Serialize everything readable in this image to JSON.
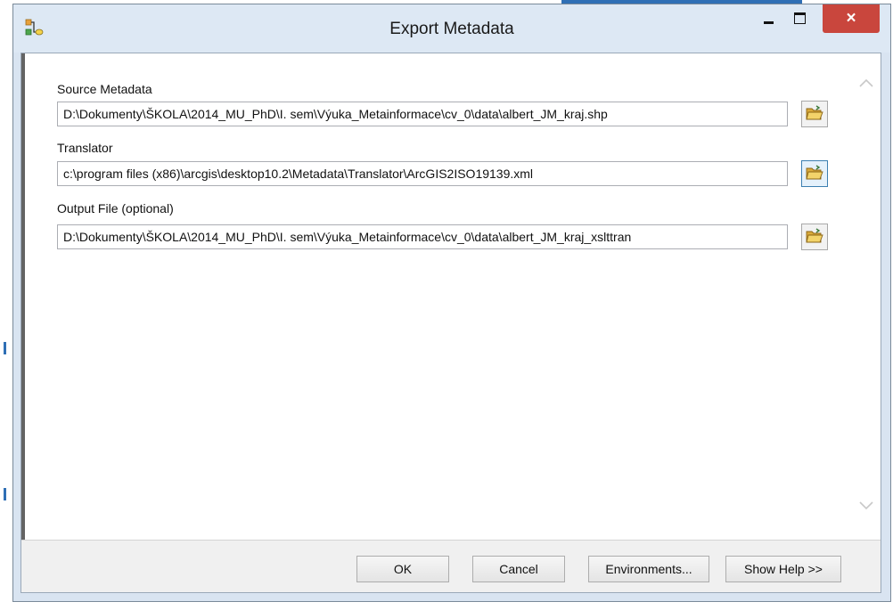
{
  "window": {
    "title": "Export Metadata"
  },
  "fields": [
    {
      "label": "Source Metadata",
      "value": "D:\\Dokumenty\\ŠKOLA\\2014_MU_PhD\\I. sem\\Výuka_Metainformace\\cv_0\\data\\albert_JM_kraj.shp"
    },
    {
      "label": "Translator",
      "value": "c:\\program files (x86)\\arcgis\\desktop10.2\\Metadata\\Translator\\ArcGIS2ISO19139.xml"
    },
    {
      "label": "Output File (optional)",
      "value": "D:\\Dokumenty\\ŠKOLA\\2014_MU_PhD\\I. sem\\Výuka_Metainformace\\cv_0\\data\\albert_JM_kraj_xslttran"
    }
  ],
  "buttons": {
    "ok": "OK",
    "cancel": "Cancel",
    "environments": "Environments...",
    "show_help": "Show Help >>"
  },
  "icons": {
    "app": "model-builder-icon",
    "browse": "open-folder-icon",
    "close": "×"
  },
  "colors": {
    "close_button": "#c9463d",
    "titlebar": "#dde8f4",
    "folder": "#e8c14d"
  }
}
